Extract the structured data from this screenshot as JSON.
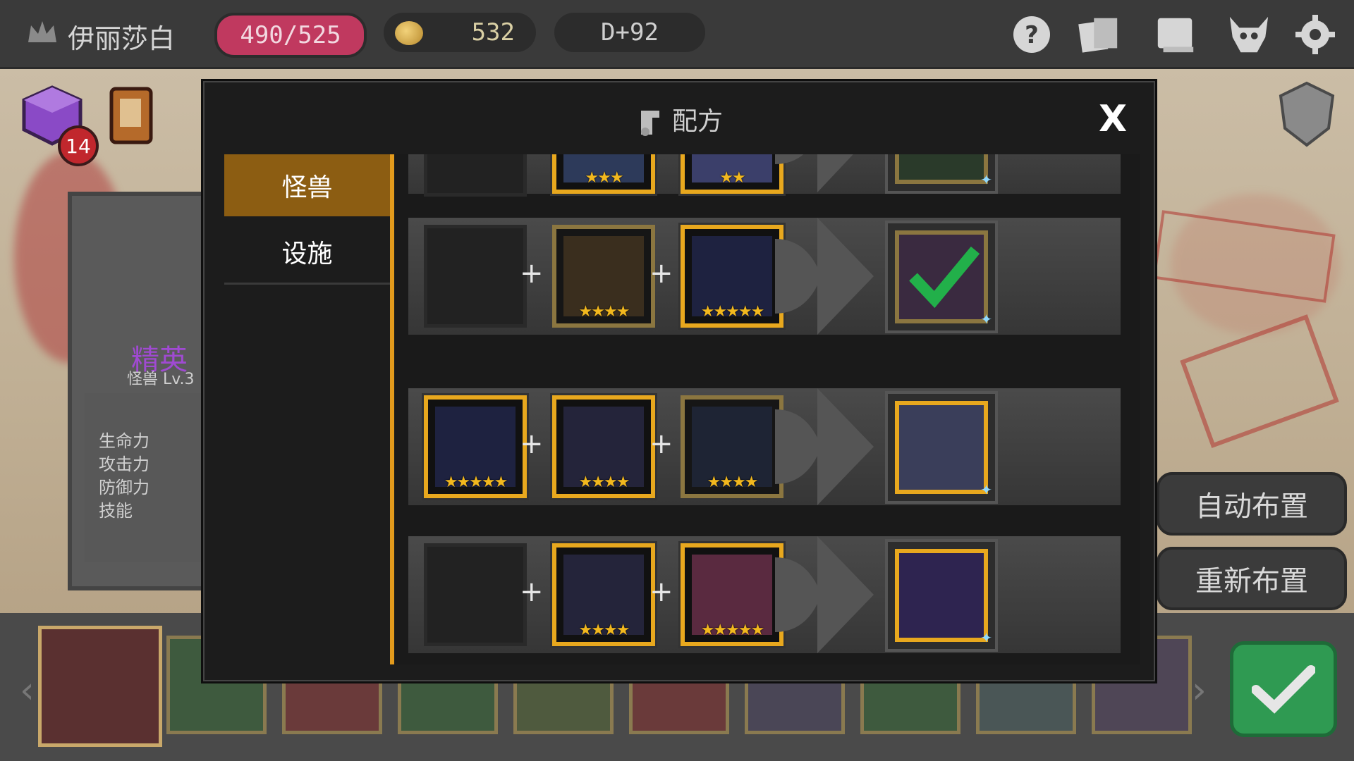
{
  "topbar": {
    "player_name": "伊丽莎白",
    "hp": "490/525",
    "gold": "532",
    "day": "D+92",
    "icons": [
      "help-icon",
      "cards-icon",
      "book-icon",
      "demon-skull-icon",
      "gear-icon"
    ]
  },
  "left_panel": {
    "inventory_badge": "14",
    "rank": "精英",
    "type_level": "怪兽 Lv.3",
    "stats": [
      "生命力",
      "攻击力",
      "防御力",
      "技能"
    ]
  },
  "right_buttons": {
    "auto_place": "自动布置",
    "reset_place": "重新布置"
  },
  "modal": {
    "title": "配方",
    "close": "X",
    "tabs": [
      {
        "label": "怪兽",
        "active": true
      },
      {
        "label": "设施",
        "active": false
      }
    ],
    "recipes": [
      {
        "slots": [
          "empty",
          "gold",
          "gold"
        ],
        "stars": [
          0,
          3,
          2
        ],
        "result_highlight": false,
        "result_checked": true
      },
      {
        "slots": [
          "empty",
          "dim",
          "gold"
        ],
        "stars": [
          0,
          4,
          5
        ],
        "result_highlight": false,
        "result_checked": true
      },
      {
        "slots": [
          "gold",
          "gold",
          "dim"
        ],
        "stars": [
          5,
          4,
          4
        ],
        "result_highlight": true,
        "result_checked": false
      },
      {
        "slots": [
          "empty",
          "gold",
          "gold"
        ],
        "stars": [
          0,
          4,
          5
        ],
        "result_highlight": true,
        "result_checked": false
      }
    ]
  },
  "colors": {
    "accent_orange": "#e29a1c",
    "tab_active": "#8c5d12",
    "hp_pink": "#c0395f",
    "confirm_green": "#2f9a52"
  }
}
